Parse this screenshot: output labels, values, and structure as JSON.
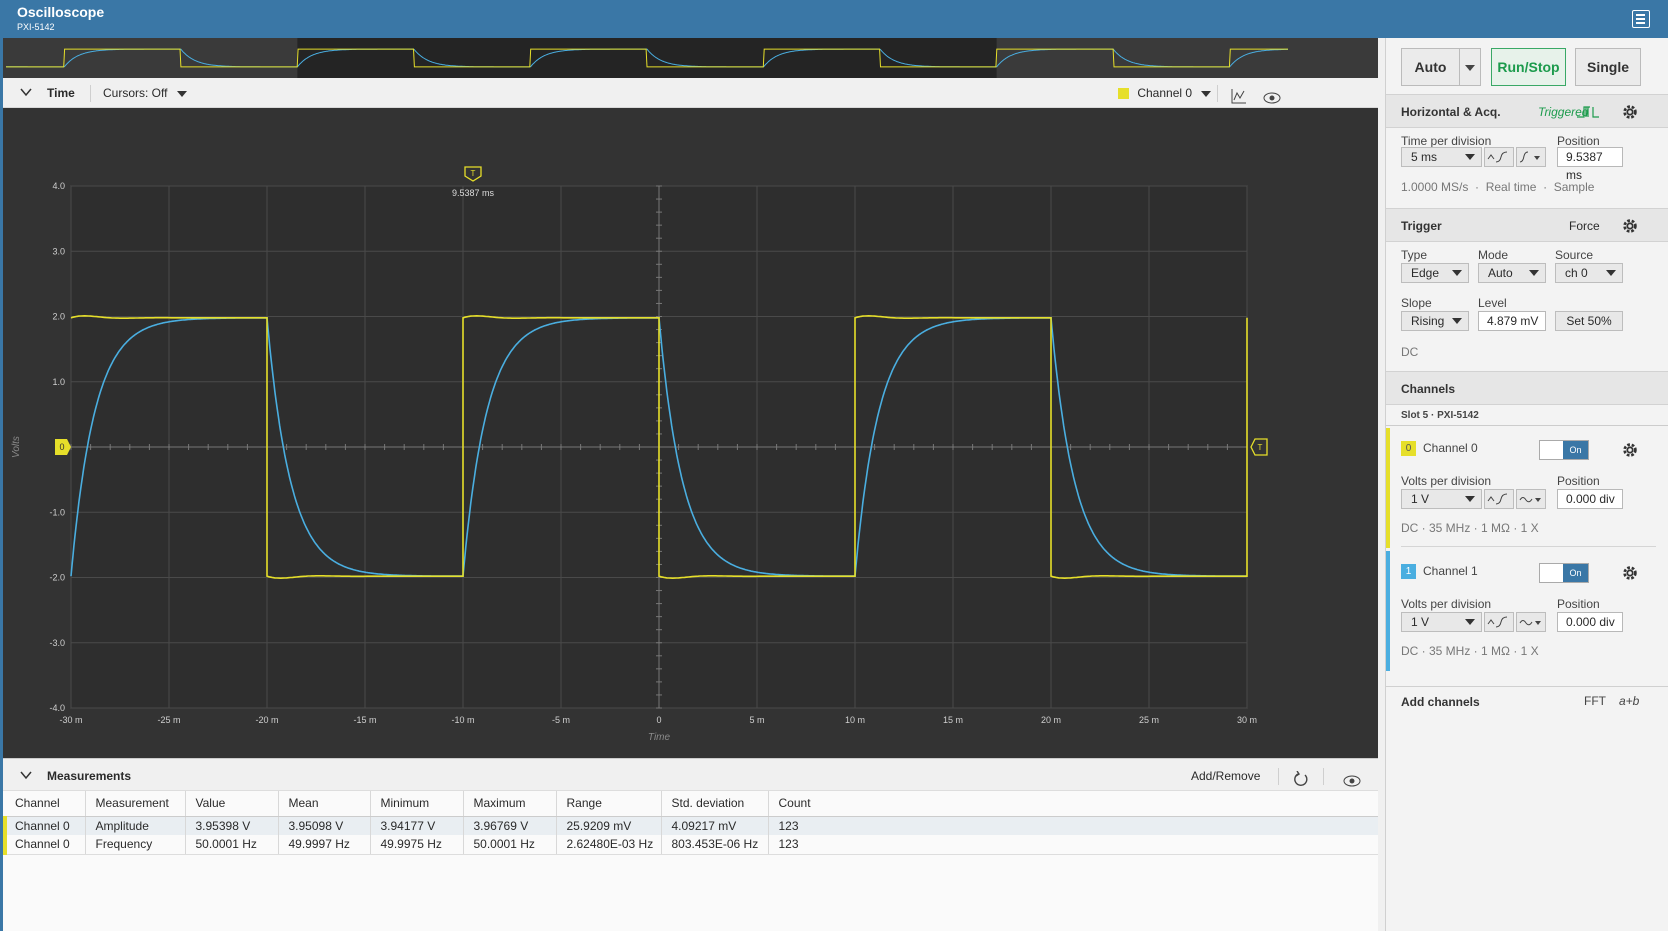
{
  "app": {
    "title": "Oscilloscope",
    "subtitle": "PXI-5142"
  },
  "timebar": {
    "label": "Time",
    "cursors": "Cursors: Off",
    "channel": "Channel 0"
  },
  "plot": {
    "trigger_time": "9.5387 ms",
    "trigger_marker": "T",
    "zero_marker": "0",
    "ylabel": "Volts",
    "xlabel": "Time",
    "yticks": [
      "4.0",
      "3.0",
      "2.0",
      "1.0",
      "0",
      "-1.0",
      "-2.0",
      "-3.0",
      "-4.0"
    ],
    "xticks": [
      "-30 m",
      "-25 m",
      "-20 m",
      "-15 m",
      "-10 m",
      "-5 m",
      "0",
      "5 m",
      "10 m",
      "15 m",
      "20 m",
      "25 m",
      "30 m"
    ],
    "colors": {
      "ch0": "#e6df2a",
      "ch1": "#4aaee0",
      "grid": "#4a4a4a",
      "bg": "#2e2e2e"
    }
  },
  "chart_data": {
    "type": "line",
    "xlim": [
      -30,
      30
    ],
    "ylim": [
      -4,
      4
    ],
    "x_unit": "ms",
    "y_unit": "V",
    "series": [
      {
        "name": "Channel 0",
        "waveform": "square",
        "high": 1.98,
        "low": -1.98,
        "period_ms": 20,
        "rising_edges_ms": [
          -30,
          -10,
          10
        ],
        "falling_edges_ms": [
          -20,
          0,
          20
        ]
      },
      {
        "name": "Channel 1",
        "waveform": "rc-filtered square",
        "high": 1.98,
        "low": -1.98,
        "period_ms": 20,
        "tau_ms": 1.2
      }
    ]
  },
  "measurements": {
    "title": "Measurements",
    "add_remove": "Add/Remove",
    "columns": [
      "Channel",
      "Measurement",
      "Value",
      "Mean",
      "Minimum",
      "Maximum",
      "Range",
      "Std. deviation",
      "Count"
    ],
    "rows": [
      [
        "Channel 0",
        "Amplitude",
        "3.95398 V",
        "3.95098 V",
        "3.94177 V",
        "3.96769 V",
        "25.9209 mV",
        "4.09217 mV",
        "123"
      ],
      [
        "Channel 0",
        "Frequency",
        "50.0001 Hz",
        "49.9997 Hz",
        "49.9975 Hz",
        "50.0001 Hz",
        "2.62480E-03 Hz",
        "803.453E-06 Hz",
        "123"
      ]
    ]
  },
  "controls": {
    "auto": "Auto",
    "runstop": "Run/Stop",
    "single": "Single"
  },
  "horizontal": {
    "title": "Horizontal & Acq.",
    "status": "Triggered",
    "tpd_label": "Time per division",
    "tpd_value": "5 ms",
    "pos_label": "Position",
    "pos_value": "9.5387 ms",
    "info": [
      "1.0000 MS/s",
      "Real time",
      "Sample"
    ]
  },
  "trigger": {
    "title": "Trigger",
    "force": "Force",
    "type_label": "Type",
    "type_value": "Edge",
    "mode_label": "Mode",
    "mode_value": "Auto",
    "source_label": "Source",
    "source_value": "ch 0",
    "slope_label": "Slope",
    "slope_value": "Rising",
    "level_label": "Level",
    "level_value": "4.879 mV",
    "set50": "Set 50%",
    "coupling": "DC"
  },
  "channels": {
    "title": "Channels",
    "slot": "Slot 5 · PXI-5142",
    "list": [
      {
        "idx": "0",
        "name": "Channel 0",
        "toggle": "On",
        "vpd_label": "Volts per division",
        "vpd_value": "1 V",
        "pos_label": "Position",
        "pos_value": "0.000 div",
        "info": "DC · 35 MHz · 1 MΩ · 1 X"
      },
      {
        "idx": "1",
        "name": "Channel 1",
        "toggle": "On",
        "vpd_label": "Volts per division",
        "vpd_value": "1 V",
        "pos_label": "Position",
        "pos_value": "0.000 div",
        "info": "DC · 35 MHz · 1 MΩ · 1 X"
      }
    ],
    "add": "Add channels",
    "fft": "FFT",
    "math": "a+b"
  }
}
